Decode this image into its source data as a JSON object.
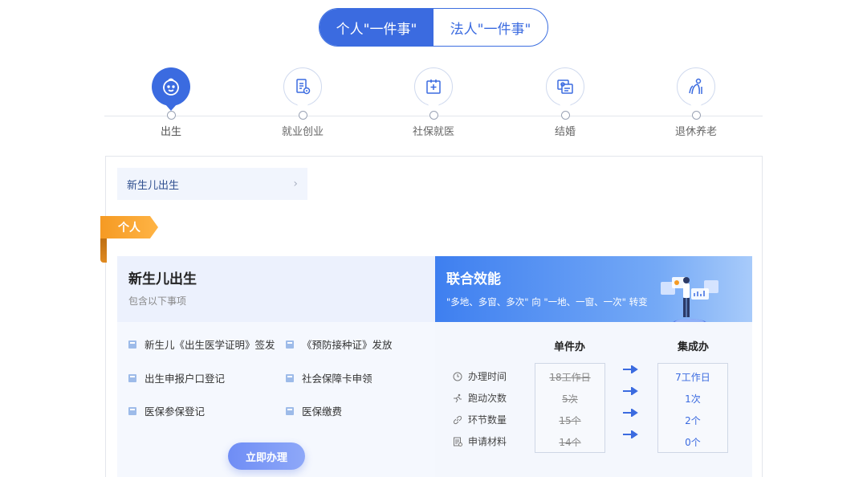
{
  "top_tabs": [
    {
      "label": "个人\"一件事\"",
      "active": true
    },
    {
      "label": "法人\"一件事\"",
      "active": false
    }
  ],
  "stages": [
    {
      "label": "出生",
      "icon": "baby-face-icon",
      "active": true
    },
    {
      "label": "就业创业",
      "icon": "document-badge-icon",
      "active": false
    },
    {
      "label": "社保就医",
      "icon": "medical-plus-icon",
      "active": false
    },
    {
      "label": "结婚",
      "icon": "marriage-certificate-icon",
      "active": false
    },
    {
      "label": "退休养老",
      "icon": "elderly-person-icon",
      "active": false
    }
  ],
  "sub_nav": {
    "label": "新生儿出生"
  },
  "ribbon": {
    "label": "个人"
  },
  "left_card": {
    "title": "新生儿出生",
    "subtitle": "包含以下事项",
    "items": [
      "新生儿《出生医学证明》签发",
      "《预防接种证》发放",
      "出生申报户口登记",
      "社会保障卡申领",
      "医保参保登记",
      "医保缴费"
    ],
    "cta_label": "立即办理"
  },
  "right_card": {
    "title": "联合效能",
    "subtitle": "\"多地、多窗、多次\" 向 \"一地、一窗、一次\" 转变",
    "col_single": "单件办",
    "col_integrated": "集成办",
    "metrics": [
      {
        "label": "办理时间",
        "icon": "clock-icon",
        "old": "18工作日",
        "new": "7工作日"
      },
      {
        "label": "跑动次数",
        "icon": "running-icon",
        "old": "5次",
        "new": "1次"
      },
      {
        "label": "环节数量",
        "icon": "link-icon",
        "old": "15个",
        "new": "2个"
      },
      {
        "label": "申请材料",
        "icon": "material-doc-icon",
        "old": "14个",
        "new": "0个"
      }
    ]
  },
  "colors": {
    "primary": "#3b6be0",
    "ribbon": "#f59a23",
    "light_bg": "#f4f7fd"
  }
}
